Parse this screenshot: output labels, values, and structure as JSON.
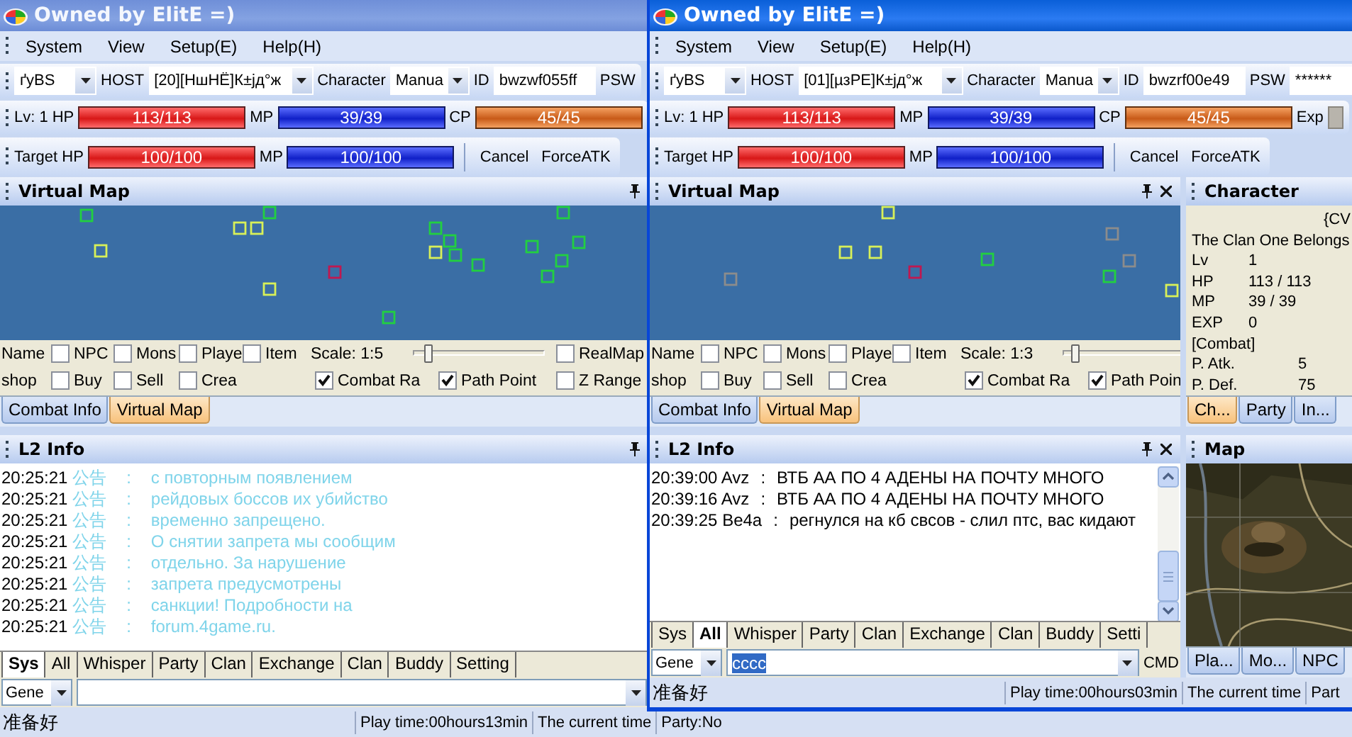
{
  "windows": [
    {
      "title": "Owned by ElitE =)",
      "active": false,
      "menu": [
        "System",
        "View",
        "Setup(E)",
        "Help(H)"
      ],
      "login": {
        "server": "ґyBS",
        "host_label": "HOST",
        "host": "[20][НшНЁ]К±јд°ж",
        "character_label": "Character",
        "character": "Manua",
        "id_label": "ID",
        "id": "bwzwf055ff",
        "psw_label": "PSW"
      },
      "stats": {
        "lv_label": "Lv:",
        "lv": "1",
        "bars": [
          {
            "kind": "hp",
            "label": "HP",
            "reading": "113/113",
            "level": 1
          },
          {
            "kind": "mp",
            "label": "MP",
            "reading": "39/39",
            "level": 1
          },
          {
            "kind": "cp",
            "label": "CP",
            "reading": "45/45",
            "level": 1
          }
        ]
      },
      "target": {
        "label": "Target HP",
        "bars": [
          {
            "kind": "hp",
            "reading": "100/100",
            "level": 1
          },
          {
            "kind": "mp",
            "label": "MP",
            "reading": "100/100",
            "level": 1
          }
        ],
        "buttons": [
          "Cancel",
          "ForceATK"
        ]
      },
      "virtual_map": {
        "title": "Virtual Map",
        "closable": false,
        "rows": [
          {
            "label": "Name",
            "checks": [
              {
                "label": "NPC",
                "checked": false
              },
              {
                "label": "Mons",
                "checked": false
              },
              {
                "label": "Playe",
                "checked": false
              },
              {
                "label": "Item",
                "checked": false
              }
            ]
          },
          {
            "label": "shop",
            "checks": [
              {
                "label": "Buy",
                "checked": false
              },
              {
                "label": "Sell",
                "checked": false
              },
              {
                "label": "Crea",
                "checked": false
              },
              {
                "label": "Combat Ra",
                "checked": true
              },
              {
                "label": "Path Point",
                "checked": true
              }
            ]
          }
        ],
        "scale": {
          "label": "Scale: 1:5",
          "level": 0.12
        },
        "side_checks": [
          {
            "label": "RealMap",
            "checked": false
          },
          {
            "label": "Z Range",
            "checked": false
          }
        ],
        "tabs": [
          {
            "label": "Combat Info",
            "selected": false
          },
          {
            "label": "Virtual Map",
            "selected": true
          }
        ]
      },
      "l2_info": {
        "title": "L2 Info",
        "closable": false,
        "lines": [
          {
            "kind": "notice",
            "time": "20:25:21",
            "sender": "公告",
            "separator": ":",
            "text": "с повторным появлением"
          },
          {
            "kind": "notice",
            "time": "20:25:21",
            "sender": "公告",
            "separator": ":",
            "text": "рейдовых боссов их убийство"
          },
          {
            "kind": "notice",
            "time": "20:25:21",
            "sender": "公告",
            "separator": ":",
            "text": "временно запрещено."
          },
          {
            "kind": "notice",
            "time": "20:25:21",
            "sender": "公告",
            "separator": ":",
            "text": "О снятии запрета мы сообщим"
          },
          {
            "kind": "notice",
            "time": "20:25:21",
            "sender": "公告",
            "separator": ":",
            "text": "отдельно. За нарушение"
          },
          {
            "kind": "notice",
            "time": "20:25:21",
            "sender": "公告",
            "separator": ":",
            "text": "запрета предусмотрены"
          },
          {
            "kind": "notice",
            "time": "20:25:21",
            "sender": "公告",
            "separator": ":",
            "text": "санкции! Подробности на"
          },
          {
            "kind": "notice",
            "time": "20:25:21",
            "sender": "公告",
            "separator": ":",
            "text": "forum.4game.ru."
          }
        ],
        "chat_tabs": [
          {
            "label": "Sys",
            "selected": true
          },
          {
            "label": "All",
            "selected": false
          },
          {
            "label": "Whisper",
            "selected": false
          },
          {
            "label": "Party",
            "selected": false
          },
          {
            "label": "Clan",
            "selected": false
          },
          {
            "label": "Exchange",
            "selected": false
          },
          {
            "label": "Clan",
            "selected": false
          },
          {
            "label": "Buddy",
            "selected": false
          },
          {
            "label": "Setting",
            "selected": false
          }
        ],
        "channel": "Gene"
      },
      "status": [
        "准备好",
        "Play time:00hours13min",
        "The current time",
        "Party:No"
      ]
    },
    {
      "title": "Owned by ElitE =)",
      "active": true,
      "menu": [
        "System",
        "View",
        "Setup(E)",
        "Help(H)"
      ],
      "login": {
        "server": "ґyBS",
        "host_label": "HOST",
        "host": "[01][µзРЕ]К±јд°ж",
        "character_label": "Character",
        "character": "Manua",
        "id_label": "ID",
        "id": "bwzrf00e49",
        "psw_label": "PSW",
        "password": "******"
      },
      "stats": {
        "lv_label": "Lv:",
        "lv": "1",
        "bars": [
          {
            "kind": "hp",
            "label": "HP",
            "reading": "113/113",
            "level": 1
          },
          {
            "kind": "mp",
            "label": "MP",
            "reading": "39/39",
            "level": 1
          },
          {
            "kind": "cp",
            "label": "CP",
            "reading": "45/45",
            "level": 1
          },
          {
            "kind": "exp",
            "label": "Exp"
          }
        ]
      },
      "target": {
        "label": "Target HP",
        "bars": [
          {
            "kind": "hp",
            "reading": "100/100",
            "level": 1
          },
          {
            "kind": "mp",
            "label": "MP",
            "reading": "100/100",
            "level": 1
          }
        ],
        "buttons": [
          "Cancel",
          "ForceATK"
        ]
      },
      "virtual_map": {
        "title": "Virtual Map",
        "closable": true,
        "rows": [
          {
            "label": "Name",
            "checks": [
              {
                "label": "NPC",
                "checked": false
              },
              {
                "label": "Mons",
                "checked": false
              },
              {
                "label": "Playe",
                "checked": false
              },
              {
                "label": "Item",
                "checked": false
              }
            ]
          },
          {
            "label": "shop",
            "checks": [
              {
                "label": "Buy",
                "checked": false
              },
              {
                "label": "Sell",
                "checked": false
              },
              {
                "label": "Crea",
                "checked": false
              },
              {
                "label": "Combat Ra",
                "checked": true
              },
              {
                "label": "Path Poin",
                "checked": true
              }
            ]
          }
        ],
        "scale": {
          "label": "Scale: 1:3",
          "level": 0.1
        },
        "tabs": [
          {
            "label": "Combat Info",
            "selected": false
          },
          {
            "label": "Virtual Map",
            "selected": true
          }
        ]
      },
      "l2_info": {
        "title": "L2 Info",
        "closable": true,
        "lines": [
          {
            "kind": "chat",
            "time": "20:39:00",
            "sender": "Avz",
            "separator": ":",
            "text": "ВТБ АА ПО 4 АДЕНЫ НА ПОЧТУ МНОГО"
          },
          {
            "kind": "chat",
            "time": "20:39:16",
            "sender": "Avz",
            "separator": ":",
            "text": "ВТБ АА ПО 4 АДЕНЫ НА ПОЧТУ МНОГО"
          },
          {
            "kind": "chat",
            "time": "20:39:25",
            "sender": "Be4a",
            "separator": ":",
            "text": "регнулся на кб свсов - слил птс, вас кидают"
          }
        ],
        "chat_tabs": [
          {
            "label": "Sys",
            "selected": false
          },
          {
            "label": "All",
            "selected": true
          },
          {
            "label": "Whisper",
            "selected": false
          },
          {
            "label": "Party",
            "selected": false
          },
          {
            "label": "Clan",
            "selected": false
          },
          {
            "label": "Exchange",
            "selected": false
          },
          {
            "label": "Clan",
            "selected": false
          },
          {
            "label": "Buddy",
            "selected": false
          },
          {
            "label": "Setti",
            "selected": false
          }
        ],
        "channel": "Gene",
        "input": "cccc",
        "cmd_label": "CMD"
      },
      "character": {
        "title": "Character",
        "heading": "{CV",
        "clan": "The Clan One Belongs",
        "stats": [
          {
            "label": "Lv",
            "value": "1"
          },
          {
            "label": "HP",
            "value": "113 / 113"
          },
          {
            "label": "MP",
            "value": "39 / 39"
          },
          {
            "label": "EXP",
            "value": "0"
          }
        ],
        "section": "[Combat]",
        "combat": [
          {
            "label": "P. Atk.",
            "value": "5"
          },
          {
            "label": "P. Def.",
            "value": "75"
          }
        ],
        "tabs": [
          {
            "label": "Ch...",
            "selected": true
          },
          {
            "label": "Party",
            "selected": false
          },
          {
            "label": "In...",
            "selected": false
          }
        ]
      },
      "map": {
        "title": "Map",
        "tabs": [
          {
            "label": "Pla...",
            "selected": false
          },
          {
            "label": "Mo...",
            "selected": false
          },
          {
            "label": "NPC",
            "selected": false
          }
        ]
      },
      "status": [
        "准备好",
        "Play time:00hours03min",
        "The current time",
        "Part"
      ]
    }
  ]
}
